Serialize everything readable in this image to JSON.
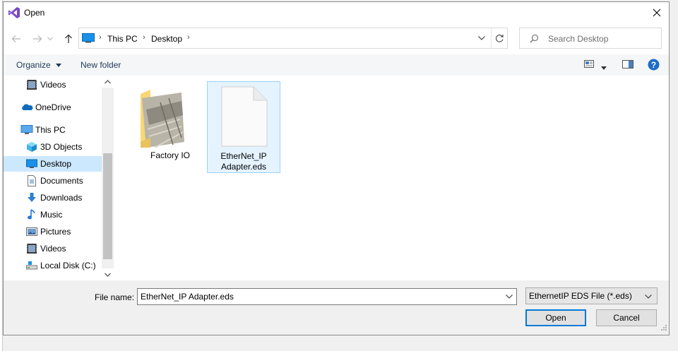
{
  "window": {
    "title": "Open",
    "close_glyph": "✕"
  },
  "nav": {
    "back_icon": "arrow-left-icon",
    "forward_icon": "arrow-right-icon",
    "dropdown_icon": "chevron-down-icon",
    "up_icon": "arrow-up-icon"
  },
  "address": {
    "breadcrumbs": [
      "This PC",
      "Desktop"
    ],
    "separator": "›"
  },
  "search": {
    "placeholder": "Search Desktop"
  },
  "toolbar": {
    "organize_label": "Organize",
    "new_folder_label": "New folder",
    "help_glyph": "?"
  },
  "sidebar": {
    "items": [
      {
        "label": "Videos",
        "icon": "videos-icon"
      },
      {
        "label": "OneDrive",
        "icon": "onedrive-icon"
      },
      {
        "label": "This PC",
        "icon": "this-pc-icon"
      },
      {
        "label": "3D Objects",
        "icon": "3d-objects-icon"
      },
      {
        "label": "Desktop",
        "icon": "desktop-icon",
        "selected": true
      },
      {
        "label": "Documents",
        "icon": "documents-icon"
      },
      {
        "label": "Downloads",
        "icon": "downloads-icon"
      },
      {
        "label": "Music",
        "icon": "music-icon"
      },
      {
        "label": "Pictures",
        "icon": "pictures-icon"
      },
      {
        "label": "Videos",
        "icon": "videos-icon"
      },
      {
        "label": "Local Disk (C:)",
        "icon": "local-disk-icon"
      }
    ]
  },
  "files": [
    {
      "label": "Factory IO",
      "icon": "folder-icon"
    },
    {
      "label_line1": "EtherNet_IP",
      "label_line2": "Adapter.eds",
      "icon": "file-icon",
      "selected": true
    }
  ],
  "footer": {
    "file_name_label": "File name:",
    "file_name_value": "EtherNet_IP Adapter.eds",
    "filter_value": "EthernetIP EDS File (*.eds)",
    "open_label": "Open",
    "cancel_label": "Cancel"
  },
  "colors": {
    "accent": "#0078d7",
    "selection": "#cce8ff",
    "folder": "#f8d775",
    "help": "#1c6dc9"
  }
}
